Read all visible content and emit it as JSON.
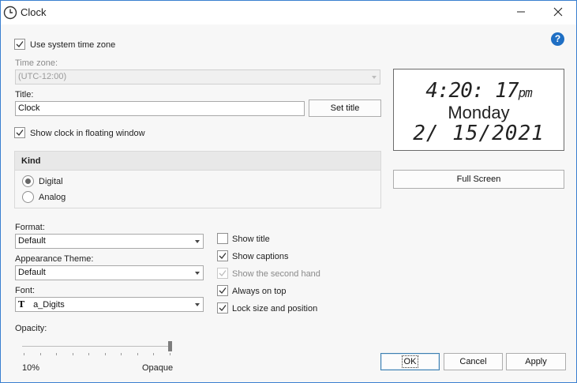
{
  "window": {
    "title": "Clock",
    "app_icon": "clock-icon",
    "help_icon": "help-icon"
  },
  "system_tz": {
    "label": "Use system time zone",
    "checked": true
  },
  "timezone": {
    "label": "Time zone:",
    "value": "(UTC-12:00)",
    "disabled": true
  },
  "title_field": {
    "label": "Title:",
    "value": "Clock",
    "set_title_label": "Set title"
  },
  "floating": {
    "label": "Show clock in floating window",
    "checked": true
  },
  "kind": {
    "header": "Kind",
    "options": [
      "Digital",
      "Analog"
    ],
    "selected": "Digital"
  },
  "preview": {
    "time": "4:20: 17",
    "ampm": "pm",
    "day": "Monday",
    "date": "2/ 15/2021"
  },
  "full_screen_label": "Full Screen",
  "format": {
    "label": "Format:",
    "value": "Default"
  },
  "theme": {
    "label": "Appearance Theme:",
    "value": "Default"
  },
  "font": {
    "label": "Font:",
    "value": "a_Digits",
    "icon": "font-icon"
  },
  "options": [
    {
      "label": "Show title",
      "checked": false,
      "disabled": false
    },
    {
      "label": "Show captions",
      "checked": true,
      "disabled": false
    },
    {
      "label": "Show the second hand",
      "checked": true,
      "disabled": true
    },
    {
      "label": "Always on top",
      "checked": true,
      "disabled": false
    },
    {
      "label": "Lock size and position",
      "checked": true,
      "disabled": false
    }
  ],
  "opacity": {
    "label": "Opacity:",
    "min_label": "10%",
    "max_label": "Opaque",
    "value_fraction": 1.0
  },
  "buttons": {
    "ok": "OK",
    "cancel": "Cancel",
    "apply": "Apply"
  },
  "colors": {
    "accent": "#1f6fc4",
    "border": "#3a7fd0"
  }
}
